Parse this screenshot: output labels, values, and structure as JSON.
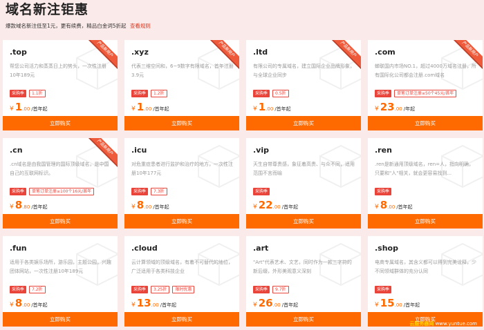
{
  "header": {
    "title": "域名新注钜惠",
    "subtitle": "爆款域名新注低至1元，更有续费，精品白金词5折起",
    "rules_link": "查看规则"
  },
  "ribbon_text": "产品新用户",
  "buy_label": "立即购买",
  "cards": [
    {
      "name": ".top",
      "desc": "帮您公司活力和蒸蒸日上的势头，一次性注册10年189元",
      "tag": "采购季",
      "tag2": "1.1折",
      "currency": "¥",
      "price_int": "1",
      "price_dec": ".00",
      "unit": "/首年起",
      "ribbon": true
    },
    {
      "name": ".xyz",
      "desc": "代表三维空间和，6~9数字有限域名，首年注册3.9元",
      "tag": "采购季",
      "tag2": "1.2折",
      "currency": "¥",
      "price_int": "1",
      "price_dec": ".00",
      "unit": "/首年起",
      "ribbon": true
    },
    {
      "name": ".ltd",
      "desc": "有限公司的专属域名，建立国际企业品牌形象，与全球企业同步",
      "tag": "采购季",
      "tag2": "0.5折",
      "currency": "¥",
      "price_int": "1",
      "price_dec": ".00",
      "unit": "/首年起",
      "ribbon": true
    },
    {
      "name": ".com",
      "desc": "蝉联国内市场NO.1，超过4000万域名注册，所有国际化公司都会注册.com域名",
      "tag": "采购季",
      "tag2": "单笔订单注册≥50个45元/首年",
      "currency": "¥",
      "price_int": "23",
      "price_dec": ".00",
      "unit": "/年起",
      "ribbon": true
    },
    {
      "name": ".cn",
      "desc": ".cn域名是由我国管理的国际顶级域名，是中国自己的互联网标识。",
      "tag": "采购季",
      "tag2": "单笔订单注册≥100个16元/首年",
      "currency": "¥",
      "price_int": "8",
      "price_dec": ".80",
      "unit": "/首年起",
      "ribbon": true
    },
    {
      "name": ".icu",
      "desc": "对危重症患者进行监护和治疗的地方，一次性注册10年177元",
      "tag": "采购季",
      "tag2": "7.3折",
      "currency": "¥",
      "price_int": "8",
      "price_dec": ".00",
      "unit": "/首年起",
      "ribbon": false
    },
    {
      "name": ".vip",
      "desc": "天生自带尊贵感，象征着高贵、与众不同，适用范围不言而喻",
      "tag": "采购季",
      "tag2": "",
      "currency": "¥",
      "price_int": "22",
      "price_dec": ".00",
      "unit": "/首年起",
      "ribbon": false
    },
    {
      "name": ".ren",
      "desc": ".ren是新通用顶级域名，ren=人，指向明确，只要和\"人\"相关，就会更容易找到...",
      "tag": "采购季",
      "tag2": "",
      "currency": "¥",
      "price_int": "8",
      "price_dec": ".00",
      "unit": "/首年起",
      "ribbon": false
    },
    {
      "name": ".fun",
      "desc": "适用于各类娱乐场所，游乐园，主题公园，兴趣团体网站，一次性注册10年189元",
      "tag": "采购季",
      "tag2": "7.2折",
      "currency": "¥",
      "price_int": "8",
      "price_dec": ".00",
      "unit": "/首年起",
      "ribbon": false
    },
    {
      "name": ".cloud",
      "desc": "云计算领域的顶级域名，有着不可替代的地位，广泛适用于各类科技企业",
      "tag": "采购季",
      "tag2": "3.25折",
      "tag3": "限时优惠",
      "currency": "¥",
      "price_int": "13",
      "price_dec": ".00",
      "unit": "/首年起",
      "ribbon": false
    },
    {
      "name": ".art",
      "desc": "\"Art\"代表艺术、文艺，同时作为一款三字符的新后缀，外形美观意义深刻",
      "tag": "采购季",
      "tag2": "9.7折",
      "currency": "¥",
      "price_int": "26",
      "price_dec": ".00",
      "unit": "/首年起",
      "ribbon": false
    },
    {
      "name": ".shop",
      "desc": "电商专属域名，其含义都可以得到完美诠释，少不同领域群体的充分认同",
      "tag": "采购季",
      "tag2": "",
      "currency": "¥",
      "price_int": "15",
      "price_dec": ".00",
      "unit": "/首年起",
      "ribbon": false
    }
  ],
  "watermark": {
    "brand": "云服务器网",
    "site": "www.yuntue.com"
  }
}
